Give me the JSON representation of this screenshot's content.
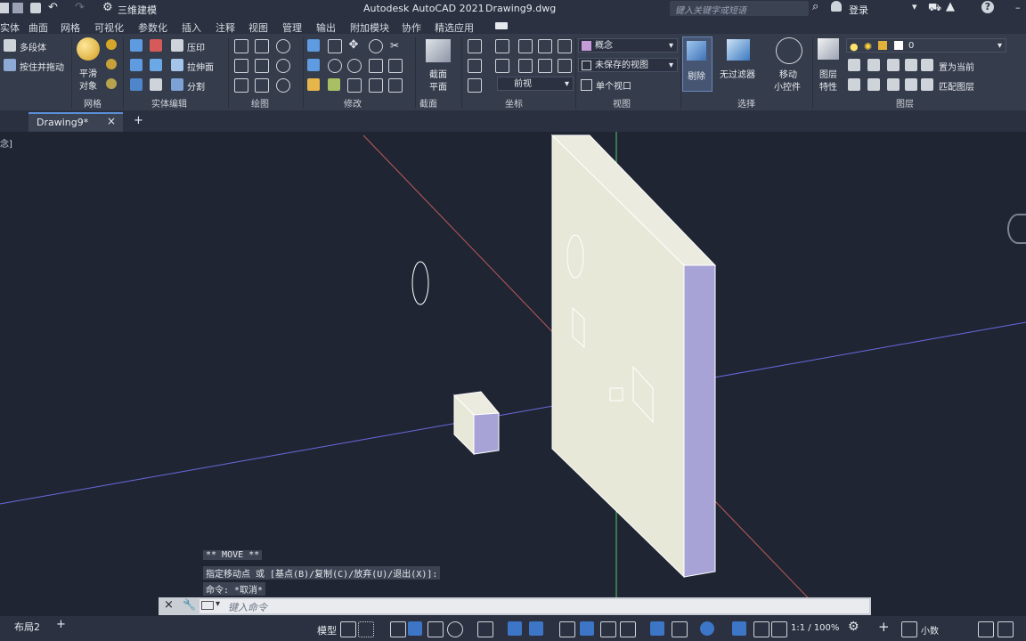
{
  "titlebar": {
    "workspace": "三维建模",
    "app_title": "Autodesk AutoCAD 2021",
    "file_name": "Drawing9.dwg",
    "search_placeholder": "键入关键字或短语",
    "signin": "登录"
  },
  "menu_tabs": [
    "实体",
    "曲面",
    "网格",
    "可视化",
    "参数化",
    "插入",
    "注释",
    "视图",
    "管理",
    "输出",
    "附加模块",
    "协作",
    "精选应用"
  ],
  "ribbon": {
    "polysolid": "多段体",
    "presspull": "按住并拖动",
    "smooth_top": "平滑",
    "smooth_bottom": "对象",
    "extrude_face": "压印",
    "extrude_face2": "拉伸面",
    "separate": "分割",
    "section_top": "截面",
    "section_bottom": "平面",
    "visual_style": "概念",
    "saved_view": "未保存的视图",
    "view_front": "前视",
    "single_viewport": "单个视口",
    "remove": "剔除",
    "no_filter": "无过滤器",
    "move_gizmo_top": "移动",
    "move_gizmo_bottom": "小控件",
    "layer_props_top": "图层",
    "layer_props_bottom": "特性",
    "layer_value": "0",
    "set_current": "置为当前",
    "match_layer": "匹配图层",
    "panels": {
      "mesh": "网格",
      "solid_edit": "实体编辑",
      "draw": "绘图",
      "modify": "修改",
      "section": "截面",
      "coordinates": "坐标",
      "view": "视图",
      "selection": "选择",
      "layers": "图层"
    }
  },
  "doc_tabs": {
    "active": "Drawing9*",
    "viewport_label": "念]"
  },
  "command": {
    "line1": "** MOVE **",
    "line2": "指定移动点 或 [基点(B)/复制(C)/放弃(U)/退出(X)]:",
    "line3": "命令: *取消*",
    "placeholder": "键入命令"
  },
  "status": {
    "layout": "布局2",
    "model": "模型",
    "scale": "1:1 / 100%",
    "units": "小数"
  },
  "colors": {
    "viewport_bg": "#1f2533",
    "ribbon_bg": "#353c4b",
    "axis_x": "#c05a5a",
    "axis_y": "#53c96a",
    "axis_z": "#6a6ae0",
    "solid_face": "#e8e8d8",
    "solid_side": "#a7a3d6"
  }
}
